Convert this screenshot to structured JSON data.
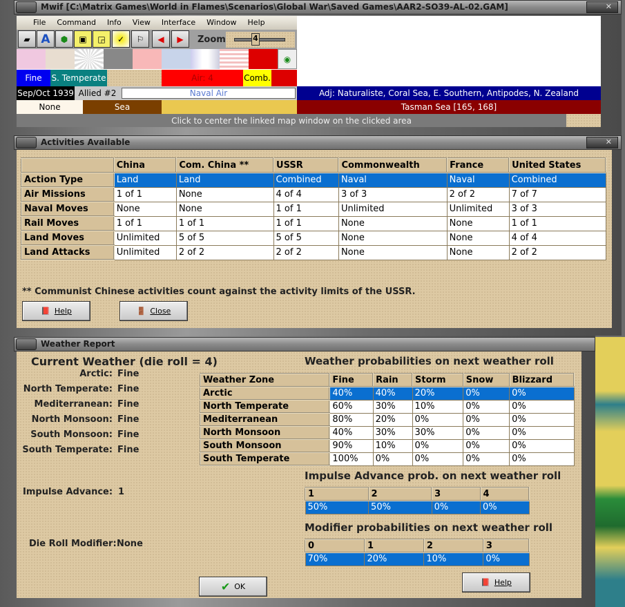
{
  "main_window": {
    "title": "Mwif [C:\\Matrix Games\\World in Flames\\Scenarios\\Global War\\Saved Games\\AAR2-SO39-AL-02.GAM]",
    "menu": [
      "File",
      "Command",
      "Info",
      "View",
      "Interface",
      "Window",
      "Help"
    ],
    "zoom_label": "Zoom",
    "zoom_value": "4",
    "status": {
      "weather": "Fine",
      "zone": "S. Temperate",
      "air": "Air: 4",
      "comb": "Comb.",
      "date": "Sep/Oct 1939",
      "impulse": "Allied #2",
      "mode": "Naval Air",
      "adjacent": "Adj: Naturaliste, Coral Sea, E. Southern, Antipodes, N. Zealand",
      "terrain_none": "None",
      "terrain": "Sea",
      "area": "Tasman Sea [165, 168]",
      "hint": "Click to center the linked map window on the clicked area"
    }
  },
  "activities": {
    "title": "Activities Available",
    "headers": [
      "",
      "China",
      "Com. China **",
      "USSR",
      "Commonwealth",
      "France",
      "United States"
    ],
    "rows": [
      [
        "Action Type",
        "Land",
        "Land",
        "Combined",
        "Naval",
        "Naval",
        "Combined"
      ],
      [
        "Air Missions",
        "1 of 1",
        "None",
        "4 of 4",
        "3 of 3",
        "2 of 2",
        "7 of 7"
      ],
      [
        "Naval Moves",
        "None",
        "None",
        "1 of 1",
        "Unlimited",
        "Unlimited",
        "3 of 3"
      ],
      [
        "Rail Moves",
        "1 of 1",
        "1 of 1",
        "1 of 1",
        "None",
        "None",
        "1 of 1"
      ],
      [
        "Land Moves",
        "Unlimited",
        "5 of 5",
        "5 of 5",
        "None",
        "None",
        "4 of 4"
      ],
      [
        "Land Attacks",
        "Unlimited",
        "2 of 2",
        "2 of 2",
        "None",
        "None",
        "2 of 2"
      ]
    ],
    "note": "** Communist Chinese activities count against the activity limits of the USSR.",
    "help": "Help",
    "close": "Close"
  },
  "weather": {
    "title": "Weather Report",
    "current_title": "Current Weather (die roll = 4)",
    "current": [
      [
        "Arctic:",
        "Fine"
      ],
      [
        "North Temperate:",
        "Fine"
      ],
      [
        "Mediterranean:",
        "Fine"
      ],
      [
        "North Monsoon:",
        "Fine"
      ],
      [
        "South Monsoon:",
        "Fine"
      ],
      [
        "South Temperate:",
        "Fine"
      ]
    ],
    "impulse_label": "Impulse Advance:",
    "impulse_value": "1",
    "modifier_label": "Die Roll Modifier:",
    "modifier_value": "None",
    "prob_title": "Weather probabilities on next weather roll",
    "prob_headers": [
      "Weather Zone",
      "Fine",
      "Rain",
      "Storm",
      "Snow",
      "Blizzard"
    ],
    "prob_rows": [
      [
        "Arctic",
        "40%",
        "40%",
        "20%",
        "0%",
        "0%"
      ],
      [
        "North Temperate",
        "60%",
        "30%",
        "10%",
        "0%",
        "0%"
      ],
      [
        "Mediterranean",
        "80%",
        "20%",
        "0%",
        "0%",
        "0%"
      ],
      [
        "North Monsoon",
        "40%",
        "30%",
        "30%",
        "0%",
        "0%"
      ],
      [
        "South Monsoon",
        "90%",
        "10%",
        "0%",
        "0%",
        "0%"
      ],
      [
        "South Temperate",
        "100%",
        "0%",
        "0%",
        "0%",
        "0%"
      ]
    ],
    "impulse_title": "Impulse Advance prob. on next weather roll",
    "impulse_headers": [
      "1",
      "2",
      "3",
      "4"
    ],
    "impulse_values": [
      "50%",
      "50%",
      "0%",
      "0%"
    ],
    "mod_title": "Modifier probabilities on next weather roll",
    "mod_headers": [
      "0",
      "1",
      "2",
      "3"
    ],
    "mod_values": [
      "70%",
      "20%",
      "10%",
      "0%"
    ],
    "ok": "OK",
    "help": "Help"
  }
}
